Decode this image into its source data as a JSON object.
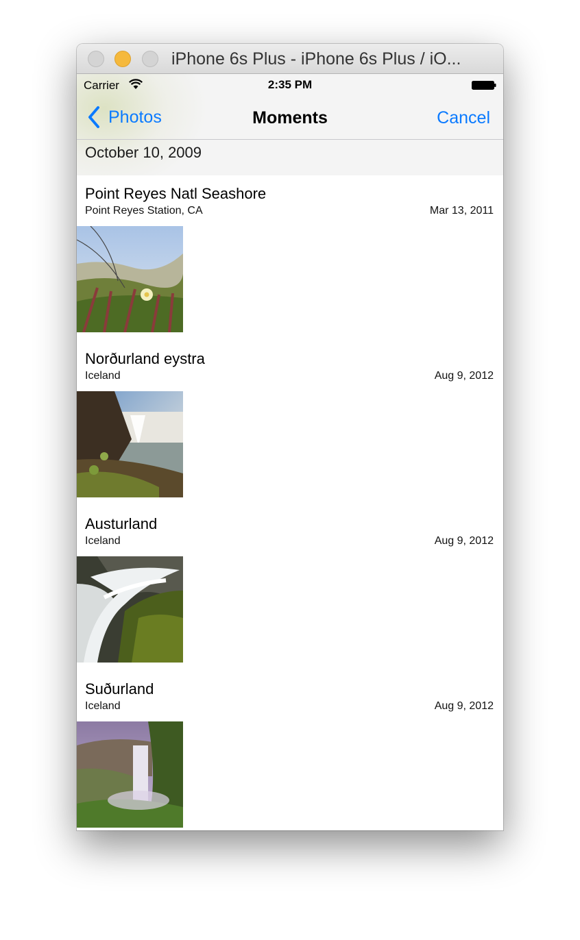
{
  "window": {
    "title": "iPhone 6s Plus - iPhone 6s Plus / iO..."
  },
  "status_bar": {
    "carrier": "Carrier",
    "time": "2:35 PM"
  },
  "nav_bar": {
    "back_label": "Photos",
    "title": "Moments",
    "cancel_label": "Cancel"
  },
  "section_header": "October 10, 2009",
  "moments": [
    {
      "title": "Point Reyes Natl Seashore",
      "location": "Point Reyes Station, CA",
      "date": "Mar 13, 2011",
      "thumbnail": "iceplant-flower-photo"
    },
    {
      "title": "Norðurland eystra",
      "location": "Iceland",
      "date": "Aug 9, 2012",
      "thumbnail": "waterfall-cliff-photo"
    },
    {
      "title": "Austurland",
      "location": "Iceland",
      "date": "Aug 9, 2012",
      "thumbnail": "mossy-waterfall-photo"
    },
    {
      "title": "Suðurland",
      "location": "Iceland",
      "date": "Aug 9, 2012",
      "thumbnail": "misty-waterfall-photo"
    }
  ],
  "colors": {
    "accent": "#0a7aff",
    "minimize_light": "#f5b93d"
  }
}
